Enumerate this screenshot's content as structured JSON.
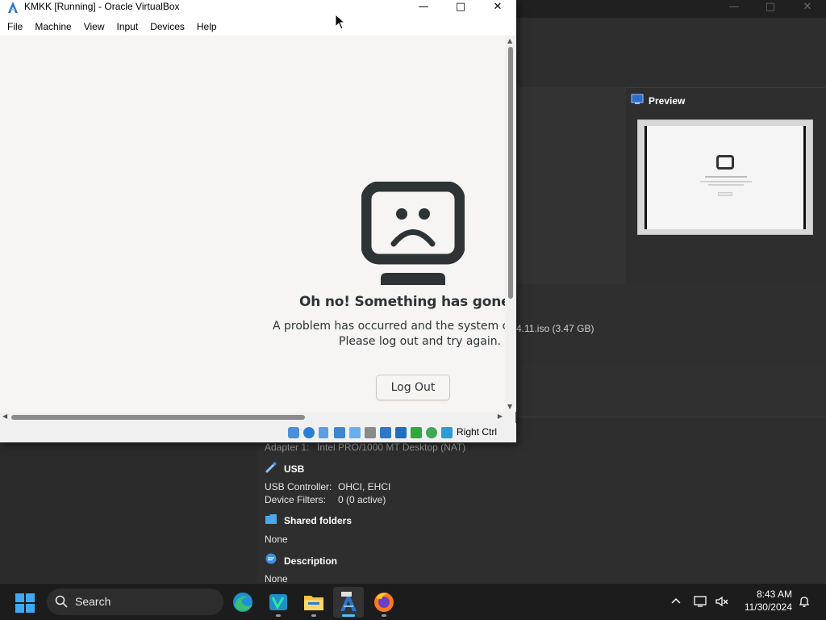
{
  "vm_window": {
    "title": "KMKK [Running] - Oracle VirtualBox",
    "menu": [
      "File",
      "Machine",
      "View",
      "Input",
      "Devices",
      "Help"
    ],
    "guest": {
      "error_title": "Oh no!  Something has gone wro",
      "error_line1": "A problem has occurred and the system can't",
      "error_line2": "Please log out and try again.",
      "logout_label": "Log Out"
    },
    "statusbar": {
      "host_key": "Right Ctrl",
      "icons": [
        "hard-disk-icon",
        "optical-drive-icon",
        "audio-icon",
        "network-icon",
        "usb-icon",
        "shared-folders-icon",
        "display-icon",
        "video-capture-icon",
        "recording-icon",
        "cpu-icon",
        "mouse-integration-icon",
        "keyboard-icon"
      ]
    }
  },
  "manager": {
    "preview_title": "Preview",
    "iso_text": "4.11.iso (3.47 GB)",
    "network": {
      "adapter_key": "Adapter 1:",
      "adapter_value": "Intel PRO/1000 MT Desktop (NAT)"
    },
    "usb": {
      "title": "USB",
      "controller_key": "USB Controller:",
      "controller_value": "OHCI, EHCI",
      "filters_key": "Device Filters:",
      "filters_value": "0 (0 active)"
    },
    "shared_folders": {
      "title": "Shared folders",
      "value": "None"
    },
    "description": {
      "title": "Description",
      "value": "None"
    }
  },
  "taskbar": {
    "search_label": "Search",
    "apps": [
      "edge-icon",
      "visual-studio-icon",
      "file-explorer-icon",
      "virtualbox-icon",
      "firefox-icon"
    ],
    "time": "8:43 AM",
    "date": "11/30/2024"
  },
  "colors": {
    "accent": "#4cc2ff",
    "guest_bg": "#f6f5f4",
    "dark_bg": "#2c2c2c"
  }
}
